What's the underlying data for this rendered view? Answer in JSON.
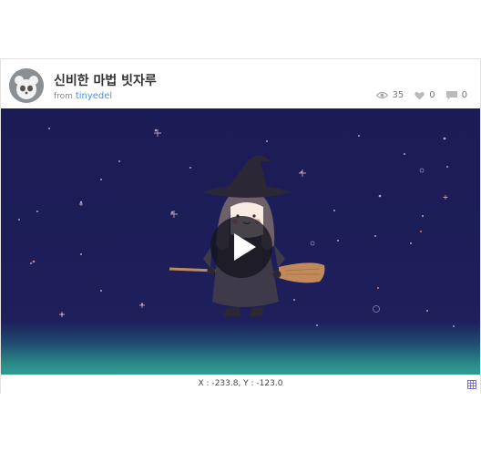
{
  "post": {
    "title": "신비한 마법 빗자루",
    "from_label": "from",
    "author": "tinyedel"
  },
  "stats": {
    "views": "35",
    "likes": "0",
    "comments": "0"
  },
  "footer": {
    "coords": "X : -233.8, Y : -123.0"
  },
  "colors": {
    "sky": "#1e1f5b",
    "ground": "#2f9c92",
    "link": "#4a90e2"
  },
  "icons": [
    "avatar",
    "eye-icon",
    "heart-icon",
    "comment-icon",
    "play-icon",
    "grid-icon"
  ]
}
